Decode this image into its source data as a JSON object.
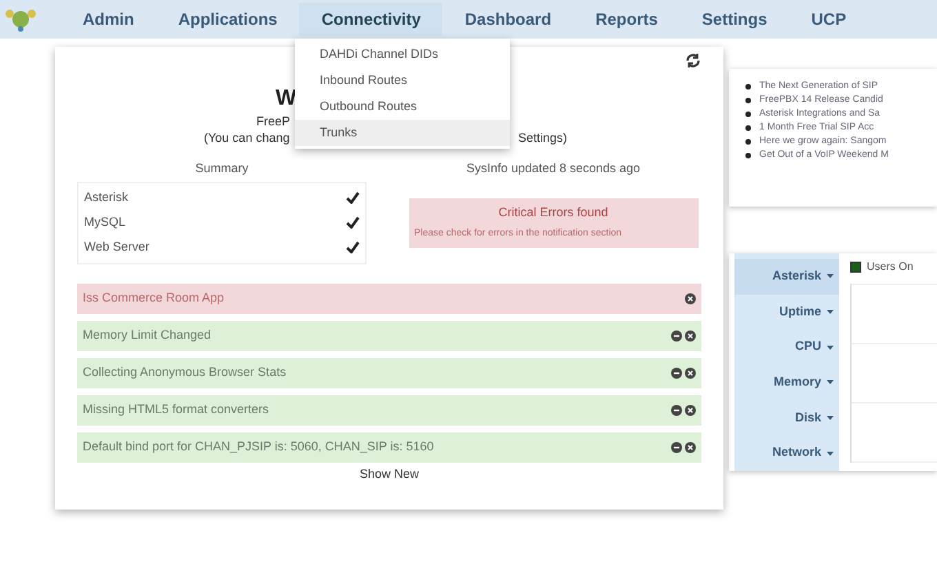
{
  "nav": [
    {
      "label": "Admin",
      "selected": false
    },
    {
      "label": "Applications",
      "selected": false
    },
    {
      "label": "Connectivity",
      "selected": true
    },
    {
      "label": "Dashboard",
      "selected": false
    },
    {
      "label": "Reports",
      "selected": false
    },
    {
      "label": "Settings",
      "selected": false
    },
    {
      "label": "UCP",
      "selected": false
    }
  ],
  "dropdown": [
    {
      "label": "DAHDi Channel DIDs",
      "selected": false
    },
    {
      "label": "Inbound Routes",
      "selected": false
    },
    {
      "label": "Outbound Routes",
      "selected": false
    },
    {
      "label": "Trunks",
      "selected": true
    }
  ],
  "welcome": {
    "title": "W",
    "line_1": "FreeP",
    "line_2_start": "(You can chang",
    "line_2_end": "Settings)"
  },
  "summary": {
    "title": "Summary",
    "items": [
      {
        "label": "Asterisk",
        "ok": true
      },
      {
        "label": "MySQL",
        "ok": true
      },
      {
        "label": "Web Server",
        "ok": true
      }
    ]
  },
  "sysinfo": "SysInfo updated 8 seconds ago",
  "critical": {
    "title": "Critical Errors found",
    "text": "Please check for errors in the notification section"
  },
  "notifications": [
    {
      "text": "Iss Commerce Room App",
      "kind": "critical"
    },
    {
      "text": "Memory Limit Changed",
      "kind": "warning"
    },
    {
      "text": "Collecting Anonymous Browser Stats",
      "kind": "warning"
    },
    {
      "text": "Missing HTML5 format converters",
      "kind": "warning"
    },
    {
      "text": "Default bind port for CHAN_PJSIP is: 5060, CHAN_SIP is: 5160",
      "kind": "warning"
    }
  ],
  "show_new": "Show New",
  "news": [
    "The Next Generation of SIP",
    "FreePBX 14 Release Candid",
    "Asterisk Integrations and Sa",
    "1 Month Free Trial SIP Acc",
    "Here we grow again: Sangom",
    "Get Out of a VoIP Weekend M"
  ],
  "stats_tabs": [
    {
      "label": "Asterisk",
      "selected": true
    },
    {
      "label": "Uptime",
      "selected": false
    },
    {
      "label": "CPU",
      "selected": false
    },
    {
      "label": "Memory",
      "selected": false
    },
    {
      "label": "Disk",
      "selected": false
    },
    {
      "label": "Network",
      "selected": false
    }
  ],
  "legend": {
    "label": "Users On",
    "color": "#1a5e1a"
  }
}
